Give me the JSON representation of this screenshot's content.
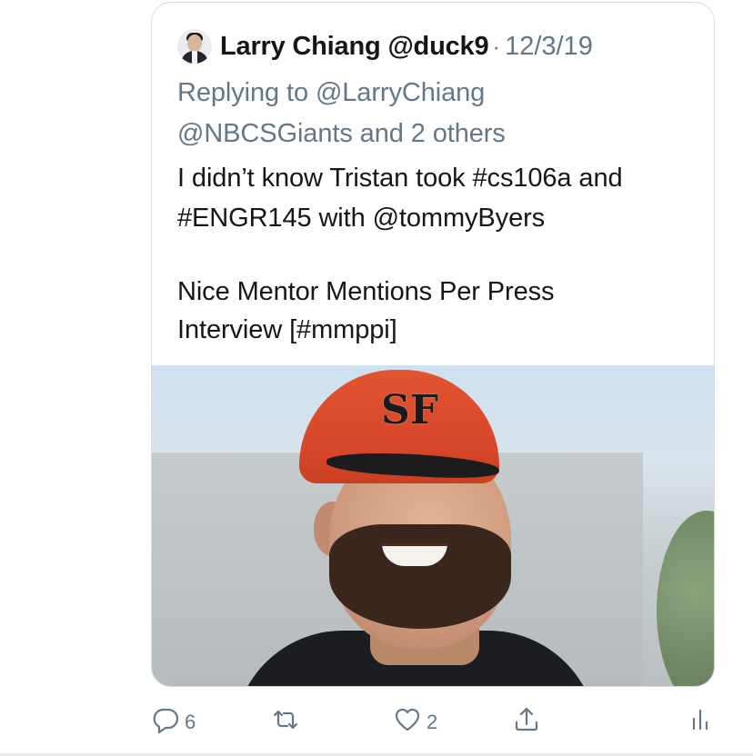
{
  "tweet": {
    "author_name": "Larry Chiang",
    "author_handle": "@duck9",
    "separator": "·",
    "date": "12/3/19",
    "replying_to_line1": "Replying to @LarryChiang",
    "replying_to_line2": "@NBCSGiants and 2 others",
    "text_lines": [
      "I didn’t know Tristan took #cs106a and",
      "#ENGR145 with @tommyByers",
      "Nice Mentor Mentions Per Press",
      "Interview [#mmppi]"
    ],
    "media": {
      "cap_logo": "SF"
    }
  },
  "actions": {
    "reply": {
      "icon": "reply-icon",
      "count": "6"
    },
    "retweet": {
      "icon": "retweet-icon",
      "count": ""
    },
    "like": {
      "icon": "heart-icon",
      "count": "2"
    },
    "share": {
      "icon": "share-icon"
    },
    "analytics": {
      "icon": "analytics-icon"
    }
  },
  "colors": {
    "text_primary": "#14171a",
    "text_secondary": "#657786",
    "border": "#d4dbe1",
    "cap_orange": "#d7462a"
  }
}
